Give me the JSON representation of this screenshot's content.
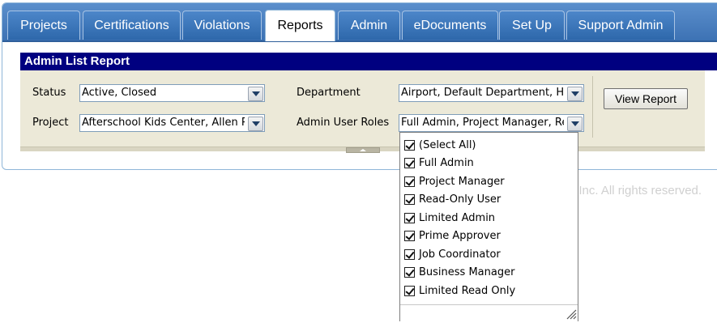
{
  "tabs": [
    {
      "label": "Projects",
      "active": false
    },
    {
      "label": "Certifications",
      "active": false
    },
    {
      "label": "Violations",
      "active": false
    },
    {
      "label": "Reports",
      "active": true
    },
    {
      "label": "Admin",
      "active": false
    },
    {
      "label": "eDocuments",
      "active": false
    },
    {
      "label": "Set Up",
      "active": false
    },
    {
      "label": "Support Admin",
      "active": false
    }
  ],
  "report": {
    "title": "Admin List Report",
    "filters": {
      "status": {
        "label": "Status",
        "value": "Active, Closed"
      },
      "project": {
        "label": "Project",
        "value": "Afterschool Kids Center, Allen Park"
      },
      "department": {
        "label": "Department",
        "value": "Airport, Default Department, Housing"
      },
      "admin_user_roles": {
        "label": "Admin User Roles",
        "value": "Full Admin, Project Manager, Read-Only User"
      }
    },
    "view_button": "View Report"
  },
  "roles_dropdown": {
    "items": [
      {
        "label": "(Select All)",
        "checked": true
      },
      {
        "label": "Full Admin",
        "checked": true
      },
      {
        "label": "Project Manager",
        "checked": true
      },
      {
        "label": "Read-Only User",
        "checked": true
      },
      {
        "label": "Limited Admin",
        "checked": true
      },
      {
        "label": "Prime Approver",
        "checked": true
      },
      {
        "label": "Job Coordinator",
        "checked": true
      },
      {
        "label": "Business Manager",
        "checked": true
      },
      {
        "label": "Limited Read Only",
        "checked": true
      }
    ]
  },
  "footer": {
    "copyright_fragment": ", Inc. All rights reserved."
  },
  "colors": {
    "tabbar": "#3d72b4",
    "panel_title": "#000080",
    "panel_bg": "#ece9d8"
  }
}
